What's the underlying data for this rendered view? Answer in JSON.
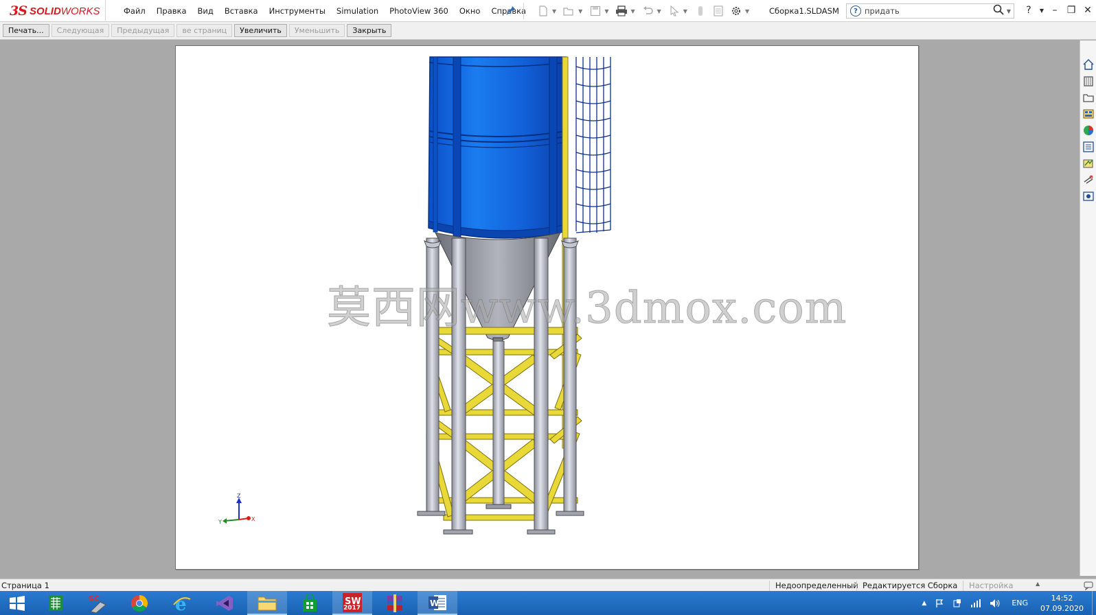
{
  "app": {
    "logo_mark": "3S",
    "logo_text_bold": "SOLID",
    "logo_text_light": "WORKS",
    "document_title": "Сборка1.SLDASM"
  },
  "menu": {
    "items": [
      "Файл",
      "Правка",
      "Вид",
      "Вставка",
      "Инструменты",
      "Simulation",
      "PhotoView 360",
      "Окно",
      "Справка"
    ]
  },
  "search": {
    "value": "придать",
    "help_glyph": "?"
  },
  "window_controls": {
    "help": "?",
    "minimize": "–",
    "restore": "❐",
    "close": "✕"
  },
  "print_preview_toolbar": {
    "print": "Печать...",
    "next": "Следующая",
    "previous": "Предыдущая",
    "pages": "ве страниц",
    "zoom_in": "Увеличить",
    "zoom_out": "Уменьшить",
    "close": "Закрыть"
  },
  "preview": {
    "watermark": "莫西网www.3dmox.com",
    "triad": {
      "x": "X",
      "y": "Y",
      "z": "Z"
    }
  },
  "statusbar": {
    "page": "Страница 1",
    "definition": "Недоопределенный",
    "editing": "Редактируется Сборка",
    "settings": "Настройка"
  },
  "taskbar": {
    "language": "ENG",
    "time": "14:52",
    "date": "07.09.2020",
    "sw_badge": "2017"
  },
  "colors": {
    "brand_red": "#d71920",
    "silo_blue": "#1a6fe0",
    "frame_yellow": "#e8d838",
    "column_gray": "#b9bcc7",
    "taskbar_blue": "#1e6ec1"
  },
  "icons": {
    "pin": "pin-icon",
    "new": "new-document-icon",
    "open": "open-icon",
    "save": "save-icon",
    "print": "print-icon",
    "undo": "undo-icon",
    "select": "select-icon",
    "rebuild": "rebuild-icon",
    "file_props": "file-properties-icon",
    "options": "options-gear-icon"
  }
}
